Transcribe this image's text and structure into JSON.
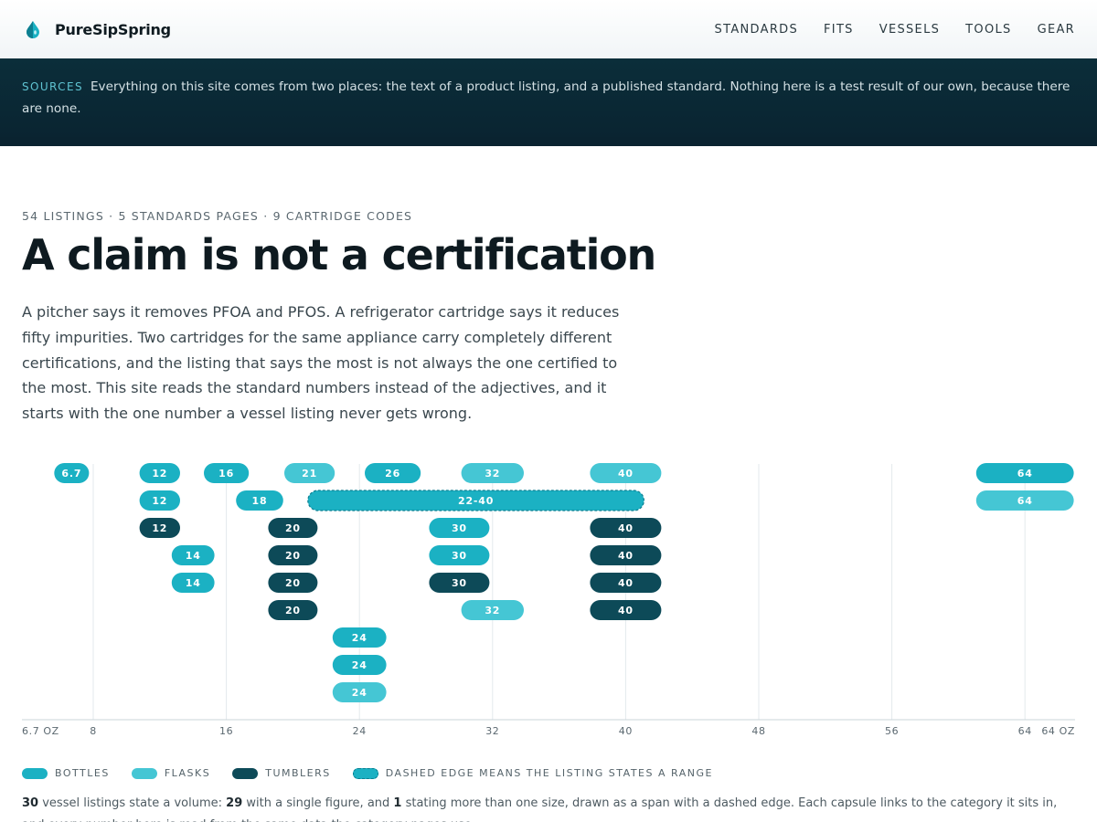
{
  "header": {
    "brand": "PureSipSpring",
    "nav": [
      "STANDARDS",
      "FITS",
      "VESSELS",
      "TOOLS",
      "GEAR"
    ]
  },
  "sources": {
    "label": "SOURCES",
    "text": "Everything on this site comes from two places: the text of a product listing, and a published standard. Nothing here is a test result of our own, because there are none."
  },
  "intro": {
    "kicker": "54 LISTINGS · 5 STANDARDS PAGES · 9 CARTRIDGE CODES",
    "title": "A claim is not a certification",
    "lede": "A pitcher says it removes PFOA and PFOS. A refrigerator cartridge says it reduces fifty impurities. Two cartridges for the same appliance carry completely different certifications, and the listing that says the most is not always the one certified to the most. This site reads the standard numbers instead of the adjectives, and it starts with the one number a vessel listing never gets wrong."
  },
  "colors": {
    "bottle": "#1bb1c3",
    "flask": "#45c6d4",
    "tumbler": "#0d4a58",
    "banner": "#0a2a36",
    "accent": "#5fc3d1"
  },
  "chart_data": {
    "type": "scatter",
    "xunit": "oz",
    "xlim": [
      6.7,
      64
    ],
    "x_ticks": [
      8,
      16,
      24,
      32,
      40,
      48,
      56,
      64
    ],
    "x_end_labels": [
      "6.7 OZ",
      "64 OZ"
    ],
    "capsules": [
      {
        "label": "6.7",
        "x": 6.7,
        "kind": "bottle",
        "row": 0
      },
      {
        "label": "12",
        "x": 12,
        "kind": "bottle",
        "row": 0
      },
      {
        "label": "16",
        "x": 16,
        "kind": "bottle",
        "row": 0
      },
      {
        "label": "21",
        "x": 21,
        "kind": "flask",
        "row": 0
      },
      {
        "label": "26",
        "x": 26,
        "kind": "bottle",
        "row": 0
      },
      {
        "label": "32",
        "x": 32,
        "kind": "flask",
        "row": 0
      },
      {
        "label": "40",
        "x": 40,
        "kind": "flask",
        "row": 0
      },
      {
        "label": "64",
        "x": 64,
        "kind": "bottle",
        "row": 0
      },
      {
        "label": "12",
        "x": 12,
        "kind": "bottle",
        "row": 1
      },
      {
        "label": "18",
        "x": 18,
        "kind": "bottle",
        "row": 1
      },
      {
        "label": "22-40",
        "x": 22,
        "x2": 40,
        "kind": "bottle",
        "row": 1,
        "range": true
      },
      {
        "label": "64",
        "x": 64,
        "kind": "flask",
        "row": 1
      },
      {
        "label": "12",
        "x": 12,
        "kind": "tumbler",
        "row": 2
      },
      {
        "label": "20",
        "x": 20,
        "kind": "tumbler",
        "row": 2
      },
      {
        "label": "30",
        "x": 30,
        "kind": "bottle",
        "row": 2
      },
      {
        "label": "40",
        "x": 40,
        "kind": "tumbler",
        "row": 2
      },
      {
        "label": "14",
        "x": 14,
        "kind": "bottle",
        "row": 3
      },
      {
        "label": "20",
        "x": 20,
        "kind": "tumbler",
        "row": 3
      },
      {
        "label": "30",
        "x": 30,
        "kind": "bottle",
        "row": 3
      },
      {
        "label": "40",
        "x": 40,
        "kind": "tumbler",
        "row": 3
      },
      {
        "label": "14",
        "x": 14,
        "kind": "bottle",
        "row": 4
      },
      {
        "label": "20",
        "x": 20,
        "kind": "tumbler",
        "row": 4
      },
      {
        "label": "30",
        "x": 30,
        "kind": "tumbler",
        "row": 4
      },
      {
        "label": "40",
        "x": 40,
        "kind": "tumbler",
        "row": 4
      },
      {
        "label": "20",
        "x": 20,
        "kind": "tumbler",
        "row": 5
      },
      {
        "label": "32",
        "x": 32,
        "kind": "flask",
        "row": 5
      },
      {
        "label": "40",
        "x": 40,
        "kind": "tumbler",
        "row": 5
      },
      {
        "label": "24",
        "x": 24,
        "kind": "bottle",
        "row": 6
      },
      {
        "label": "24",
        "x": 24,
        "kind": "bottle",
        "row": 7
      },
      {
        "label": "24",
        "x": 24,
        "kind": "flask",
        "row": 8
      }
    ]
  },
  "legend": {
    "bottles": "BOTTLES",
    "flasks": "FLASKS",
    "tumblers": "TUMBLERS",
    "range": "DASHED EDGE MEANS THE LISTING STATES A RANGE"
  },
  "note": {
    "n_total": "30",
    "t1": " vessel listings state a volume: ",
    "n_single": "29",
    "t2": " with a single figure, and ",
    "n_range": "1",
    "t3": " stating more than one size, drawn as a span with a dashed edge. Each capsule links to the category it sits in, and every number here is read from the same data the category pages use."
  }
}
